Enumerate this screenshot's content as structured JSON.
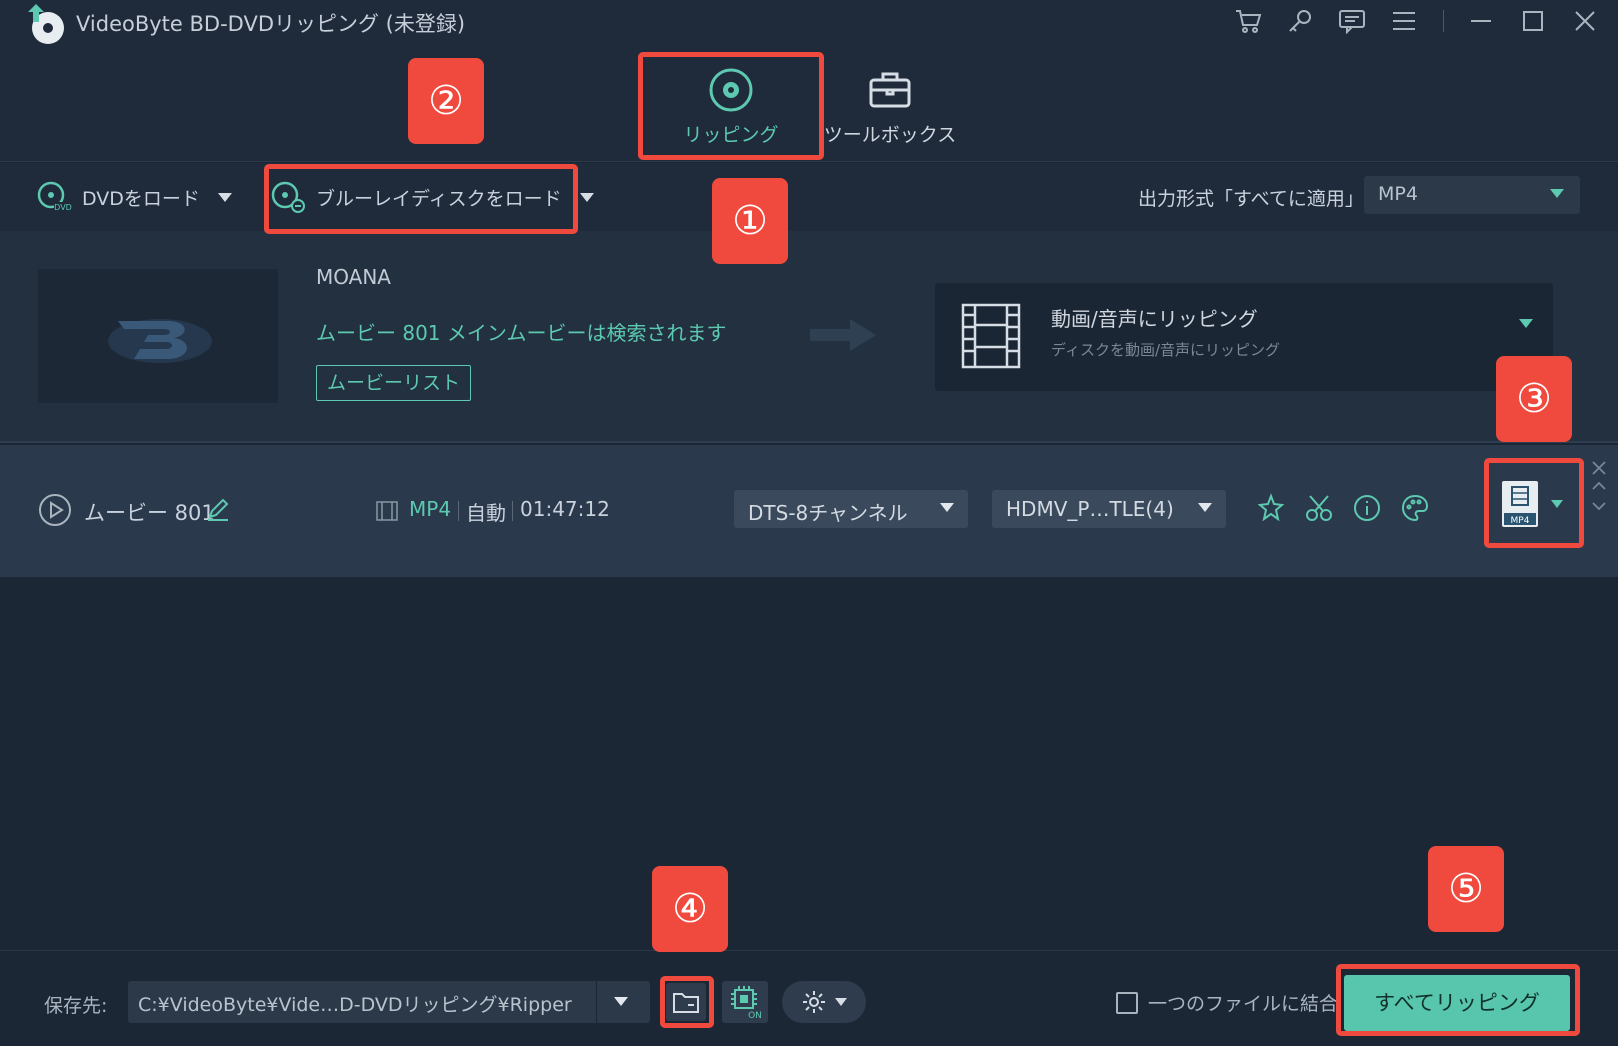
{
  "app": {
    "title": "VideoByte BD-DVDリッピング (未登録)",
    "window_controls": [
      "cart-icon",
      "key-icon",
      "feedback-icon",
      "menu-icon",
      "minimize-icon",
      "maximize-icon",
      "close-icon"
    ]
  },
  "tabs": [
    {
      "label": "リッピング",
      "icon": "disc-icon",
      "active": true
    },
    {
      "label": "ツールボックス",
      "icon": "toolbox-icon",
      "active": false
    }
  ],
  "toolbar": {
    "load_dvd": "DVDをロード",
    "load_bluray": "ブルーレイディスクをロード",
    "output_format_label": "出力形式「すべてに適用」:",
    "output_format_value": "MP4"
  },
  "disc": {
    "name": "MOANA",
    "info": "ムービー 801 メインムービーは検索されます",
    "movie_list_button": "ムービーリスト",
    "rip_mode_title": "動画/音声にリッピング",
    "rip_mode_subtitle": "ディスクを動画/音声にリッピング"
  },
  "title_row": {
    "name": "ムービー 801",
    "format": "MP4",
    "mode": "自動",
    "duration": "01:47:12",
    "audio_track": "DTS-8チャンネル",
    "subtitle_track": "HDMV_P…TLE(4)",
    "output_badge": "MP4",
    "tools": [
      "enhance-icon",
      "cut-icon",
      "info-icon",
      "palette-icon"
    ]
  },
  "bottom": {
    "save_label": "保存先:",
    "save_path": "C:¥VideoByte¥Vide…D-DVDリッピング¥Ripper",
    "hw_badge": "ON",
    "merge_label": "一つのファイルに結合",
    "rip_all_button": "すべてリッピング"
  },
  "annotations": [
    "①",
    "②",
    "③",
    "④",
    "⑤"
  ],
  "colors": {
    "accent": "#5cc9b0",
    "annotation": "#f04a3e",
    "background": "#1c2736"
  }
}
